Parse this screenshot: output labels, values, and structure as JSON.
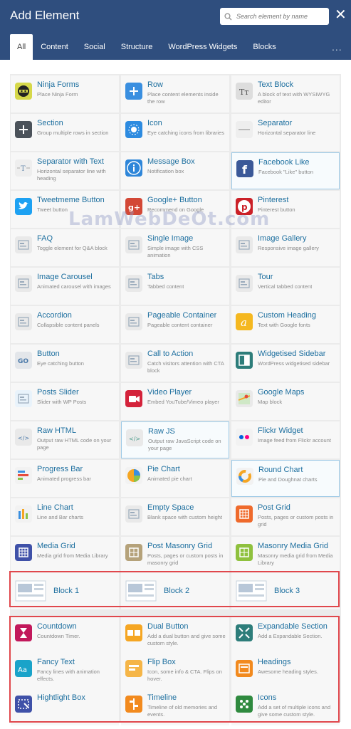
{
  "header": {
    "title": "Add Element",
    "search_placeholder": "Search element by name",
    "close": "✕",
    "more": "..."
  },
  "tabs": [
    {
      "label": "All",
      "active": true
    },
    {
      "label": "Content"
    },
    {
      "label": "Social"
    },
    {
      "label": "Structure"
    },
    {
      "label": "WordPress Widgets"
    },
    {
      "label": "Blocks"
    }
  ],
  "watermark": "LamWebDeOt.com",
  "elements": [
    {
      "name": "Ninja Forms",
      "desc": "Place Ninja Form",
      "icon": "ninja-icon",
      "color": "#d6d84a"
    },
    {
      "name": "Row",
      "desc": "Place content elements inside the row",
      "icon": "plus-icon",
      "color": "#3a8fe0"
    },
    {
      "name": "Text Block",
      "desc": "A block of text with WYSIWYG editor",
      "icon": "text-icon",
      "color": "#dddddd"
    },
    {
      "name": "Section",
      "desc": "Group multiple rows in section",
      "icon": "plus-icon",
      "color": "#4b525a"
    },
    {
      "name": "Icon",
      "desc": "Eye catching icons from libraries",
      "icon": "sun-icon",
      "color": "#2d8be0"
    },
    {
      "name": "Separator",
      "desc": "Horizontal separator line",
      "icon": "line-icon",
      "color": "#eeeeee"
    },
    {
      "name": "Separator with Text",
      "desc": "Horizontal separator line with heading",
      "icon": "text-separator-icon",
      "color": "#eeeeee"
    },
    {
      "name": "Message Box",
      "desc": "Notification box",
      "icon": "info-icon",
      "color": "#2e86d9"
    },
    {
      "name": "Facebook Like",
      "desc": "Facebook \"Like\" button",
      "icon": "facebook-icon",
      "color": "#3b5998"
    },
    {
      "name": "Tweetmeme Button",
      "desc": "Tweet button",
      "icon": "twitter-icon",
      "color": "#1da1f2"
    },
    {
      "name": "Google+ Button",
      "desc": "Recommend on Google",
      "icon": "google-plus-icon",
      "color": "#d34836"
    },
    {
      "name": "Pinterest",
      "desc": "Pinterest button",
      "icon": "pinterest-icon",
      "color": "#cb2027"
    },
    {
      "name": "FAQ",
      "desc": "Toggle element for Q&A block",
      "icon": "faq-icon",
      "color": "#e9e9e9"
    },
    {
      "name": "Single Image",
      "desc": "Simple image with CSS animation",
      "icon": "image-icon",
      "color": "#e9e9e9"
    },
    {
      "name": "Image Gallery",
      "desc": "Responsive image gallery",
      "icon": "gallery-icon",
      "color": "#e9e9e9"
    },
    {
      "name": "Image Carousel",
      "desc": "Animated carousel with images",
      "icon": "carousel-icon",
      "color": "#e9e9e9"
    },
    {
      "name": "Tabs",
      "desc": "Tabbed content",
      "icon": "tabs-icon",
      "color": "#e9e9e9"
    },
    {
      "name": "Tour",
      "desc": "Vertical tabbed content",
      "icon": "tour-icon",
      "color": "#e9e9e9"
    },
    {
      "name": "Accordion",
      "desc": "Collapsible content panels",
      "icon": "accordion-icon",
      "color": "#e9e9e9"
    },
    {
      "name": "Pageable Container",
      "desc": "Pageable content container",
      "icon": "pageable-icon",
      "color": "#e9e9e9"
    },
    {
      "name": "Custom Heading",
      "desc": "Text with Google fonts",
      "icon": "heading-a-icon",
      "color": "#f5b820"
    },
    {
      "name": "Button",
      "desc": "Eye catching button",
      "icon": "go-icon",
      "color": "#e3e6ea"
    },
    {
      "name": "Call to Action",
      "desc": "Catch visitors attention with CTA block",
      "icon": "cta-icon",
      "color": "#e9e9e9"
    },
    {
      "name": "Widgetised Sidebar",
      "desc": "WordPress widgetised sidebar",
      "icon": "sidebar-icon",
      "color": "#2d7d7a"
    },
    {
      "name": "Posts Slider",
      "desc": "Slider with WP Posts",
      "icon": "slider-icon",
      "color": "#e9f3fb"
    },
    {
      "name": "Video Player",
      "desc": "Embed YouTube/Vimeo player",
      "icon": "video-icon",
      "color": "#d4233b"
    },
    {
      "name": "Google Maps",
      "desc": "Map block",
      "icon": "map-icon",
      "color": "#e9e9e9"
    },
    {
      "name": "Raw HTML",
      "desc": "Output raw HTML code on your page",
      "icon": "html-icon",
      "color": "#e9e9e9"
    },
    {
      "name": "Raw JS",
      "desc": "Output raw JavaScript code on your page",
      "icon": "js-icon",
      "color": "#e9e9e9"
    },
    {
      "name": "Flickr Widget",
      "desc": "Image feed from Flickr account",
      "icon": "flickr-icon",
      "color": "#f2f2f2"
    },
    {
      "name": "Progress Bar",
      "desc": "Animated progress bar",
      "icon": "progress-icon",
      "color": "#f2f2f2"
    },
    {
      "name": "Pie Chart",
      "desc": "Animated pie chart",
      "icon": "pie-chart-icon",
      "color": "#f2f2f2"
    },
    {
      "name": "Round Chart",
      "desc": "Pie and Doughnat charts",
      "icon": "round-chart-icon",
      "color": "#f2f2f2"
    },
    {
      "name": "Line Chart",
      "desc": "Line and Bar charts",
      "icon": "line-chart-icon",
      "color": "#f2f2f2"
    },
    {
      "name": "Empty Space",
      "desc": "Blank space with custom height",
      "icon": "empty-space-icon",
      "color": "#e9e9e9"
    },
    {
      "name": "Post Grid",
      "desc": "Posts, pages or custom posts in grid",
      "icon": "grid-icon",
      "color": "#ef6a2c"
    },
    {
      "name": "Media Grid",
      "desc": "Media grid from Media Library",
      "icon": "media-grid-icon",
      "color": "#3f51a8"
    },
    {
      "name": "Post Masonry Grid",
      "desc": "Posts, pages or custom posts in masonry grid",
      "icon": "masonry-icon",
      "color": "#b5a27a"
    },
    {
      "name": "Masonry Media Grid",
      "desc": "Masonry media grid from Media Library",
      "icon": "masonry-media-icon",
      "color": "#8fc13e"
    }
  ],
  "blocks": [
    {
      "name": "Block 1",
      "icon": "block-layout-icon"
    },
    {
      "name": "Block 2",
      "icon": "block-layout-icon"
    },
    {
      "name": "Block 3",
      "icon": "block-layout-icon"
    }
  ],
  "extras": [
    {
      "name": "Countdown",
      "desc": "Countdown Timer.",
      "icon": "hourglass-icon",
      "color": "#c2185b"
    },
    {
      "name": "Dual Button",
      "desc": "Add a dual button and give some custom style.",
      "icon": "dual-button-icon",
      "color": "#f5a623"
    },
    {
      "name": "Expandable Section",
      "desc": "Add a Expandable Section.",
      "icon": "expand-icon",
      "color": "#2d7d7a"
    },
    {
      "name": "Fancy Text",
      "desc": "Fancy lines with animation effects.",
      "icon": "fancy-text-icon",
      "color": "#1aa3c9"
    },
    {
      "name": "Flip Box",
      "desc": "Icon, some info & CTA. Flips on hover.",
      "icon": "flip-box-icon",
      "color": "#f5b547"
    },
    {
      "name": "Headings",
      "desc": "Awesome heading styles.",
      "icon": "headings-icon",
      "color": "#f28a1e"
    },
    {
      "name": "Hightlight Box",
      "desc": "",
      "icon": "highlight-icon",
      "color": "#3f51a8"
    },
    {
      "name": "Timeline",
      "desc": "Timeline of old memories and events.",
      "icon": "timeline-icon",
      "color": "#f28a1e"
    },
    {
      "name": "Icons",
      "desc": "Add a set of multiple icons and give some custom style.",
      "icon": "icons-grid-icon",
      "color": "#2f8a3f"
    }
  ]
}
